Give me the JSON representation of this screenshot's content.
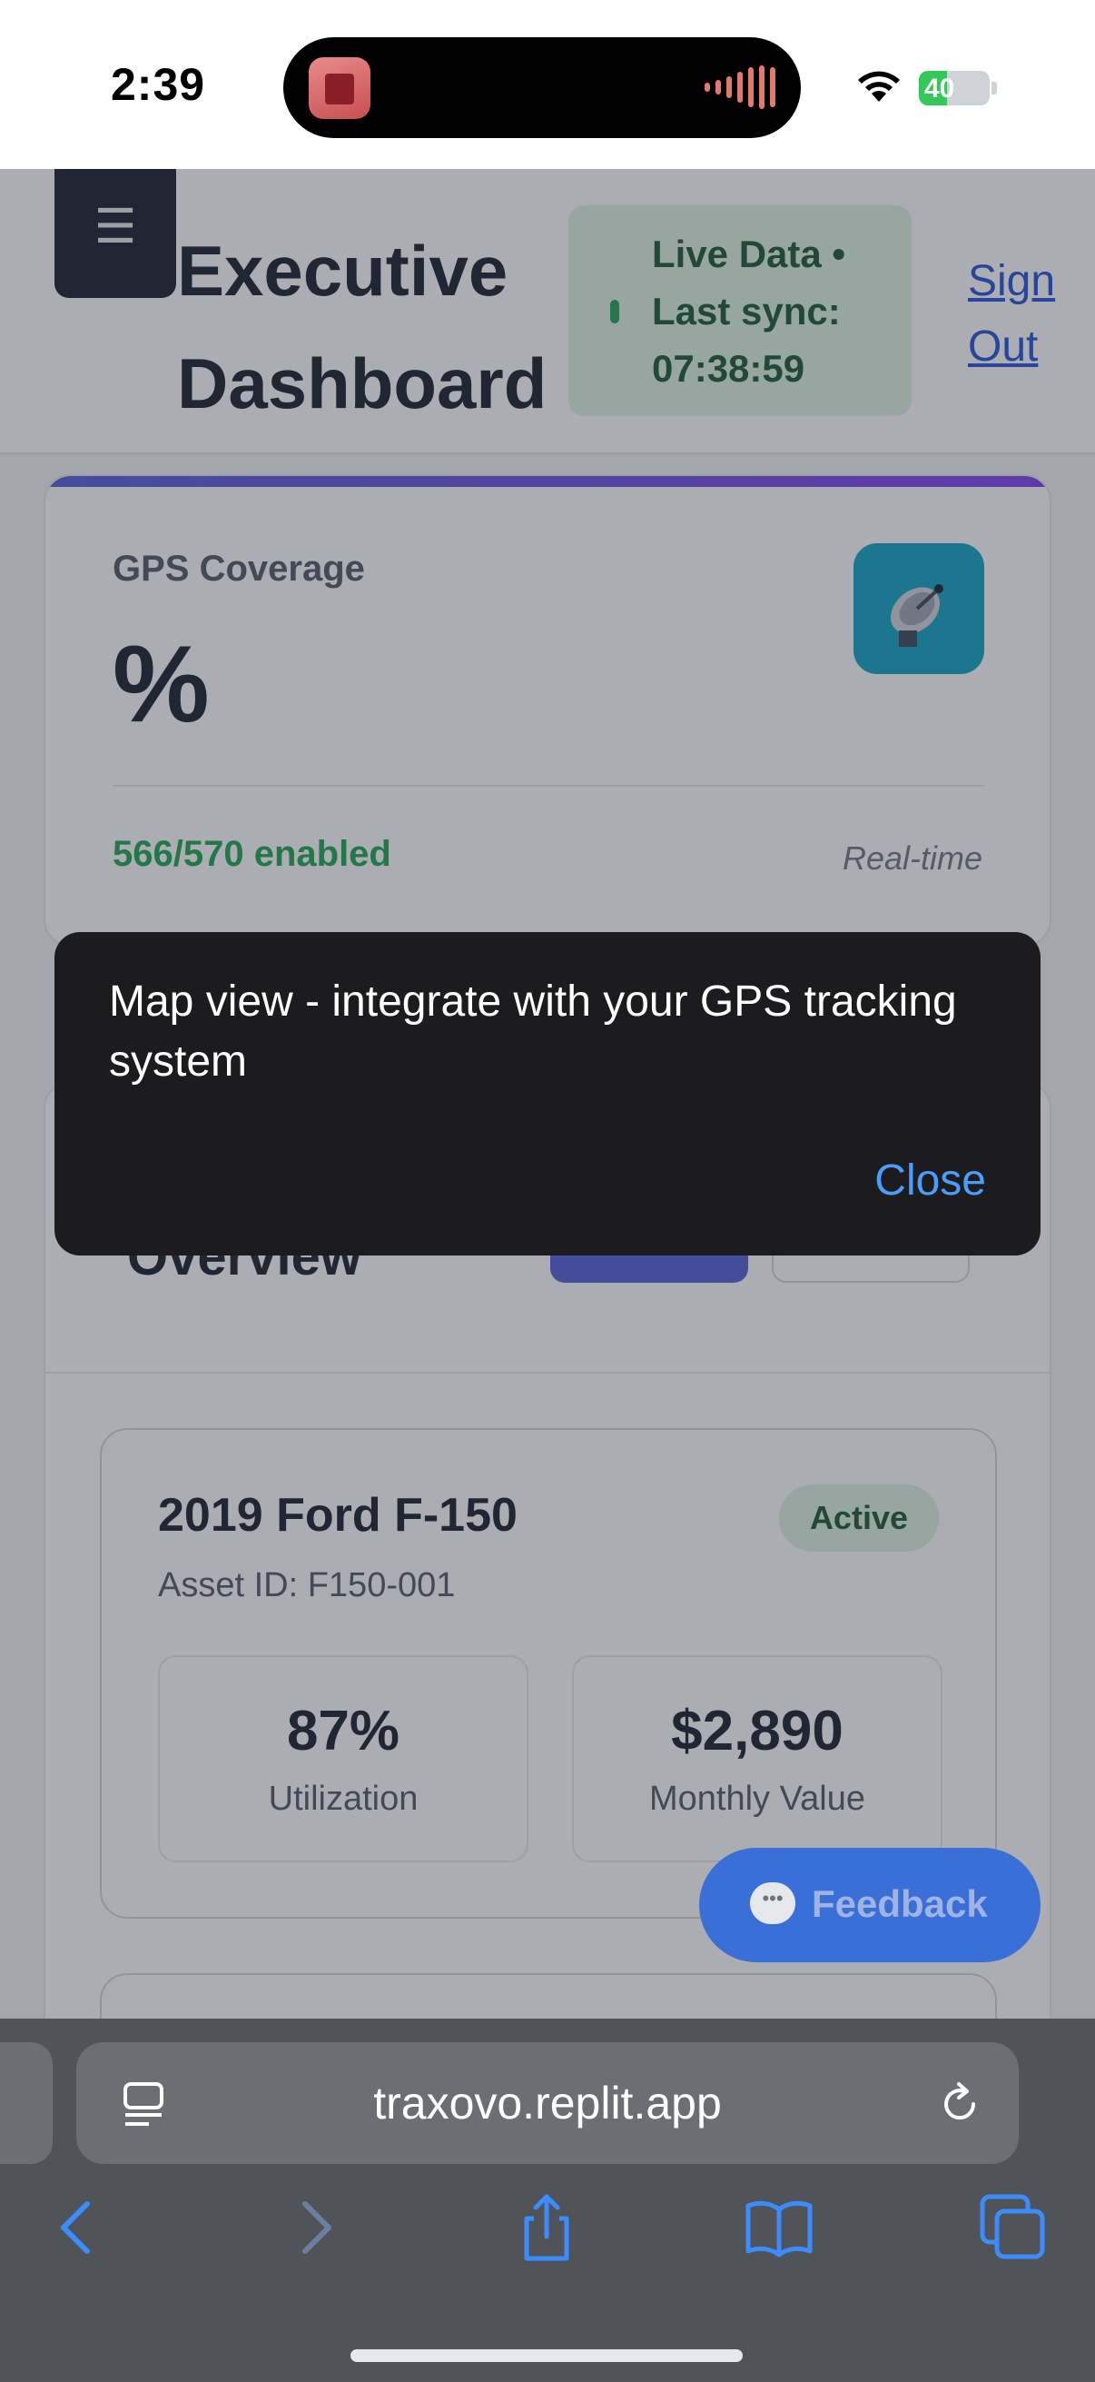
{
  "status_bar": {
    "time": "2:39",
    "battery_percent": 40,
    "battery_label": "40",
    "charging": true
  },
  "header": {
    "menu_icon": "hamburger-icon",
    "title": "Executive Dashboard",
    "live_status": "Live Data • Last sync: 07:38:59",
    "sign_out": "Sign Out"
  },
  "gps_card": {
    "label": "GPS Coverage",
    "value": "%",
    "icon": "satellite-dish-icon",
    "enabled_text": "566/570 enabled",
    "update_mode": "Real-time"
  },
  "overview": {
    "title": "Overview"
  },
  "assets": [
    {
      "name": "2019 Ford F-150",
      "status": "Active",
      "asset_id": "Asset ID: F150-001",
      "metrics": [
        {
          "value": "87%",
          "label": "Utilization"
        },
        {
          "value": "$2,890",
          "label": "Monthly Value"
        }
      ]
    }
  ],
  "feedback": {
    "label": "Feedback",
    "icon": "chat-bubble-icon"
  },
  "toast": {
    "message": "Map view - integrate with your GPS tracking system",
    "close_label": "Close"
  },
  "browser": {
    "url": "traxovo.replit.app",
    "icons": [
      "page-menu-icon",
      "reload-icon",
      "back-icon",
      "forward-icon",
      "share-icon",
      "bookmarks-icon",
      "tabs-icon"
    ]
  },
  "colors": {
    "accent": "#4f5bd5",
    "success": "#16a34a",
    "toast_bg": "#1c1c1e",
    "link": "#4a9cff",
    "gps_icon_bg": "#0aa3c2"
  }
}
